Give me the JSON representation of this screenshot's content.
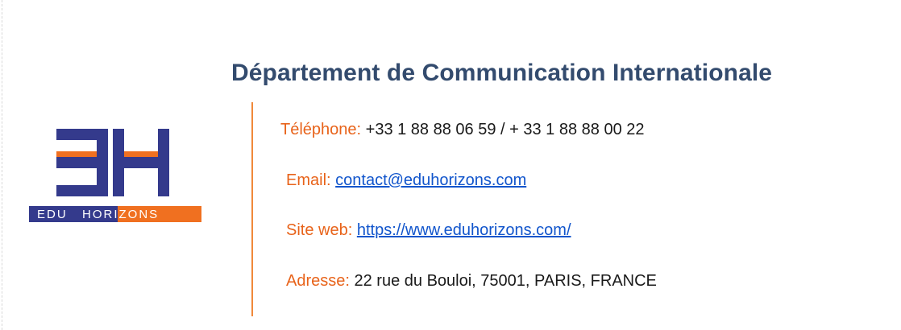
{
  "signature": {
    "department_title": "Département de Communication Internationale",
    "logo": {
      "brand_text_part1": "EDU",
      "brand_text_part2": "HORIZONS",
      "colors": {
        "navy": "#343a8c",
        "orange": "#f07020"
      }
    },
    "contacts": [
      {
        "label": "Téléphone:",
        "value": "+33 1 88 88 06 59 / + 33 1 88 88 00 22",
        "is_link": false
      },
      {
        "label": "Email:",
        "value": "contact@eduhorizons.com",
        "is_link": true
      },
      {
        "label": "Site web:",
        "value": "https://www.eduhorizons.com/",
        "is_link": true
      },
      {
        "label": "Adresse:",
        "value": "22 rue du Bouloi, 75001, PARIS, FRANCE",
        "is_link": false
      }
    ],
    "colors": {
      "title": "#334b6e",
      "label": "#e8631a",
      "link": "#1155cc",
      "divider": "#f0893a"
    }
  }
}
